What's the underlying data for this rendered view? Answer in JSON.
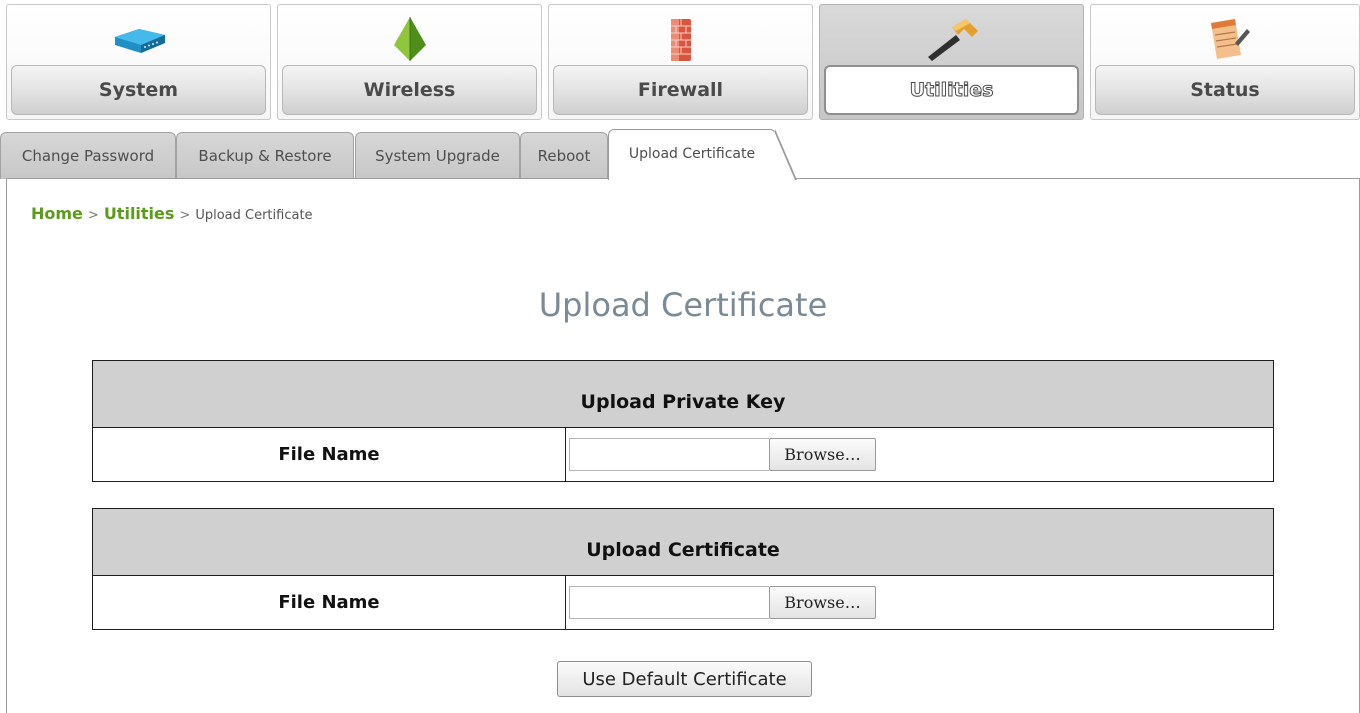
{
  "nav": {
    "items": [
      {
        "label": "System",
        "icon": "router-icon"
      },
      {
        "label": "Wireless",
        "icon": "wireless-pyramid-icon"
      },
      {
        "label": "Firewall",
        "icon": "brick-wall-icon"
      },
      {
        "label": "Utilities",
        "icon": "hammer-icon",
        "active": true
      },
      {
        "label": "Status",
        "icon": "notepad-icon"
      }
    ]
  },
  "tabs": [
    {
      "label": "Change Password"
    },
    {
      "label": "Backup & Restore"
    },
    {
      "label": "System Upgrade"
    },
    {
      "label": "Reboot"
    },
    {
      "label": "Upload Certificate",
      "active": true
    }
  ],
  "breadcrumb": {
    "home": "Home",
    "section": "Utilities",
    "current": "Upload Certificate",
    "separator": ">"
  },
  "page": {
    "title": "Upload Certificate"
  },
  "private_key": {
    "header": "Upload Private Key",
    "label": "File Name",
    "value": "",
    "browse_label": "Browse…"
  },
  "certificate": {
    "header": "Upload Certificate",
    "label": "File Name",
    "value": "",
    "browse_label": "Browse…"
  },
  "actions": {
    "default_cert_label": "Use Default Certificate"
  },
  "colors": {
    "breadcrumb_link": "#5c9a1b",
    "title": "#7a8a96",
    "table_header_bg": "#d0d0d0"
  }
}
